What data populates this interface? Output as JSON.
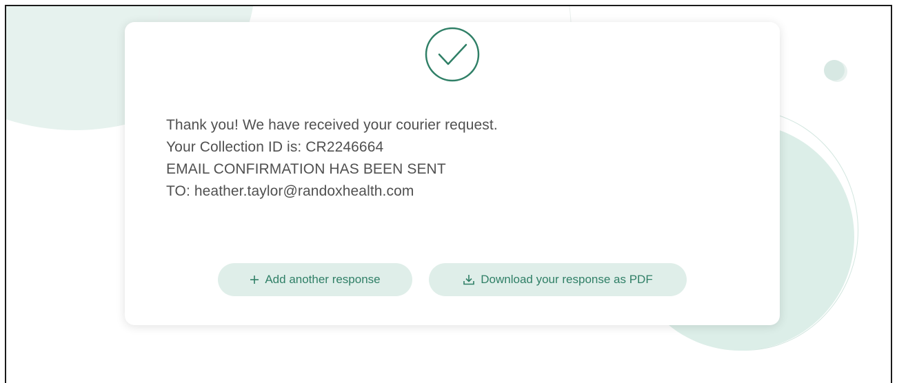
{
  "confirmation": {
    "status_icon": "check-circle-icon",
    "lines": [
      "Thank you! We have received your courier request.",
      "Your Collection ID is: CR2246664",
      "EMAIL CONFIRMATION HAS BEEN SENT",
      "TO: heather.taylor@randoxhealth.com"
    ]
  },
  "actions": {
    "add_label": "Add another response",
    "add_icon": "plus-icon",
    "download_label": "Download your response as PDF",
    "download_icon": "download-icon"
  },
  "colors": {
    "accent": "#2f7f66",
    "button_bg": "#dfeee9",
    "text": "#505050",
    "decor": "#dceee8"
  }
}
